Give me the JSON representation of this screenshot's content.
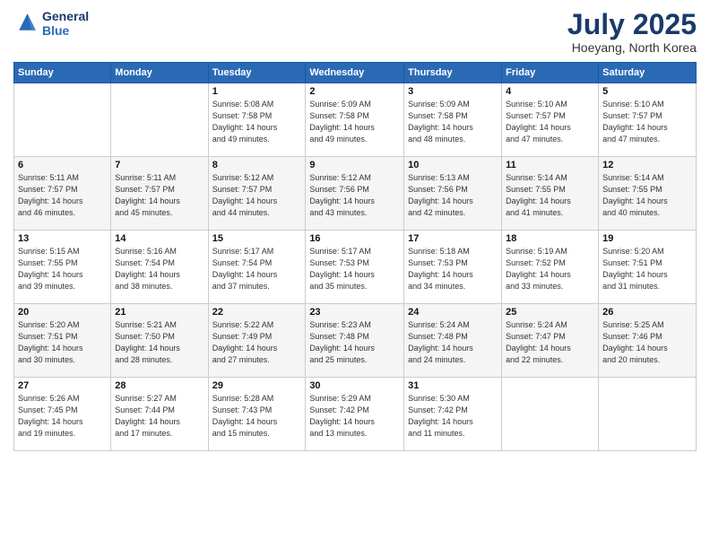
{
  "header": {
    "logo_line1": "General",
    "logo_line2": "Blue",
    "title": "July 2025",
    "subtitle": "Hoeyang, North Korea"
  },
  "weekdays": [
    "Sunday",
    "Monday",
    "Tuesday",
    "Wednesday",
    "Thursday",
    "Friday",
    "Saturday"
  ],
  "weeks": [
    [
      {
        "day": "",
        "detail": ""
      },
      {
        "day": "",
        "detail": ""
      },
      {
        "day": "1",
        "detail": "Sunrise: 5:08 AM\nSunset: 7:58 PM\nDaylight: 14 hours\nand 49 minutes."
      },
      {
        "day": "2",
        "detail": "Sunrise: 5:09 AM\nSunset: 7:58 PM\nDaylight: 14 hours\nand 49 minutes."
      },
      {
        "day": "3",
        "detail": "Sunrise: 5:09 AM\nSunset: 7:58 PM\nDaylight: 14 hours\nand 48 minutes."
      },
      {
        "day": "4",
        "detail": "Sunrise: 5:10 AM\nSunset: 7:57 PM\nDaylight: 14 hours\nand 47 minutes."
      },
      {
        "day": "5",
        "detail": "Sunrise: 5:10 AM\nSunset: 7:57 PM\nDaylight: 14 hours\nand 47 minutes."
      }
    ],
    [
      {
        "day": "6",
        "detail": "Sunrise: 5:11 AM\nSunset: 7:57 PM\nDaylight: 14 hours\nand 46 minutes."
      },
      {
        "day": "7",
        "detail": "Sunrise: 5:11 AM\nSunset: 7:57 PM\nDaylight: 14 hours\nand 45 minutes."
      },
      {
        "day": "8",
        "detail": "Sunrise: 5:12 AM\nSunset: 7:57 PM\nDaylight: 14 hours\nand 44 minutes."
      },
      {
        "day": "9",
        "detail": "Sunrise: 5:12 AM\nSunset: 7:56 PM\nDaylight: 14 hours\nand 43 minutes."
      },
      {
        "day": "10",
        "detail": "Sunrise: 5:13 AM\nSunset: 7:56 PM\nDaylight: 14 hours\nand 42 minutes."
      },
      {
        "day": "11",
        "detail": "Sunrise: 5:14 AM\nSunset: 7:55 PM\nDaylight: 14 hours\nand 41 minutes."
      },
      {
        "day": "12",
        "detail": "Sunrise: 5:14 AM\nSunset: 7:55 PM\nDaylight: 14 hours\nand 40 minutes."
      }
    ],
    [
      {
        "day": "13",
        "detail": "Sunrise: 5:15 AM\nSunset: 7:55 PM\nDaylight: 14 hours\nand 39 minutes."
      },
      {
        "day": "14",
        "detail": "Sunrise: 5:16 AM\nSunset: 7:54 PM\nDaylight: 14 hours\nand 38 minutes."
      },
      {
        "day": "15",
        "detail": "Sunrise: 5:17 AM\nSunset: 7:54 PM\nDaylight: 14 hours\nand 37 minutes."
      },
      {
        "day": "16",
        "detail": "Sunrise: 5:17 AM\nSunset: 7:53 PM\nDaylight: 14 hours\nand 35 minutes."
      },
      {
        "day": "17",
        "detail": "Sunrise: 5:18 AM\nSunset: 7:53 PM\nDaylight: 14 hours\nand 34 minutes."
      },
      {
        "day": "18",
        "detail": "Sunrise: 5:19 AM\nSunset: 7:52 PM\nDaylight: 14 hours\nand 33 minutes."
      },
      {
        "day": "19",
        "detail": "Sunrise: 5:20 AM\nSunset: 7:51 PM\nDaylight: 14 hours\nand 31 minutes."
      }
    ],
    [
      {
        "day": "20",
        "detail": "Sunrise: 5:20 AM\nSunset: 7:51 PM\nDaylight: 14 hours\nand 30 minutes."
      },
      {
        "day": "21",
        "detail": "Sunrise: 5:21 AM\nSunset: 7:50 PM\nDaylight: 14 hours\nand 28 minutes."
      },
      {
        "day": "22",
        "detail": "Sunrise: 5:22 AM\nSunset: 7:49 PM\nDaylight: 14 hours\nand 27 minutes."
      },
      {
        "day": "23",
        "detail": "Sunrise: 5:23 AM\nSunset: 7:48 PM\nDaylight: 14 hours\nand 25 minutes."
      },
      {
        "day": "24",
        "detail": "Sunrise: 5:24 AM\nSunset: 7:48 PM\nDaylight: 14 hours\nand 24 minutes."
      },
      {
        "day": "25",
        "detail": "Sunrise: 5:24 AM\nSunset: 7:47 PM\nDaylight: 14 hours\nand 22 minutes."
      },
      {
        "day": "26",
        "detail": "Sunrise: 5:25 AM\nSunset: 7:46 PM\nDaylight: 14 hours\nand 20 minutes."
      }
    ],
    [
      {
        "day": "27",
        "detail": "Sunrise: 5:26 AM\nSunset: 7:45 PM\nDaylight: 14 hours\nand 19 minutes."
      },
      {
        "day": "28",
        "detail": "Sunrise: 5:27 AM\nSunset: 7:44 PM\nDaylight: 14 hours\nand 17 minutes."
      },
      {
        "day": "29",
        "detail": "Sunrise: 5:28 AM\nSunset: 7:43 PM\nDaylight: 14 hours\nand 15 minutes."
      },
      {
        "day": "30",
        "detail": "Sunrise: 5:29 AM\nSunset: 7:42 PM\nDaylight: 14 hours\nand 13 minutes."
      },
      {
        "day": "31",
        "detail": "Sunrise: 5:30 AM\nSunset: 7:42 PM\nDaylight: 14 hours\nand 11 minutes."
      },
      {
        "day": "",
        "detail": ""
      },
      {
        "day": "",
        "detail": ""
      }
    ]
  ]
}
